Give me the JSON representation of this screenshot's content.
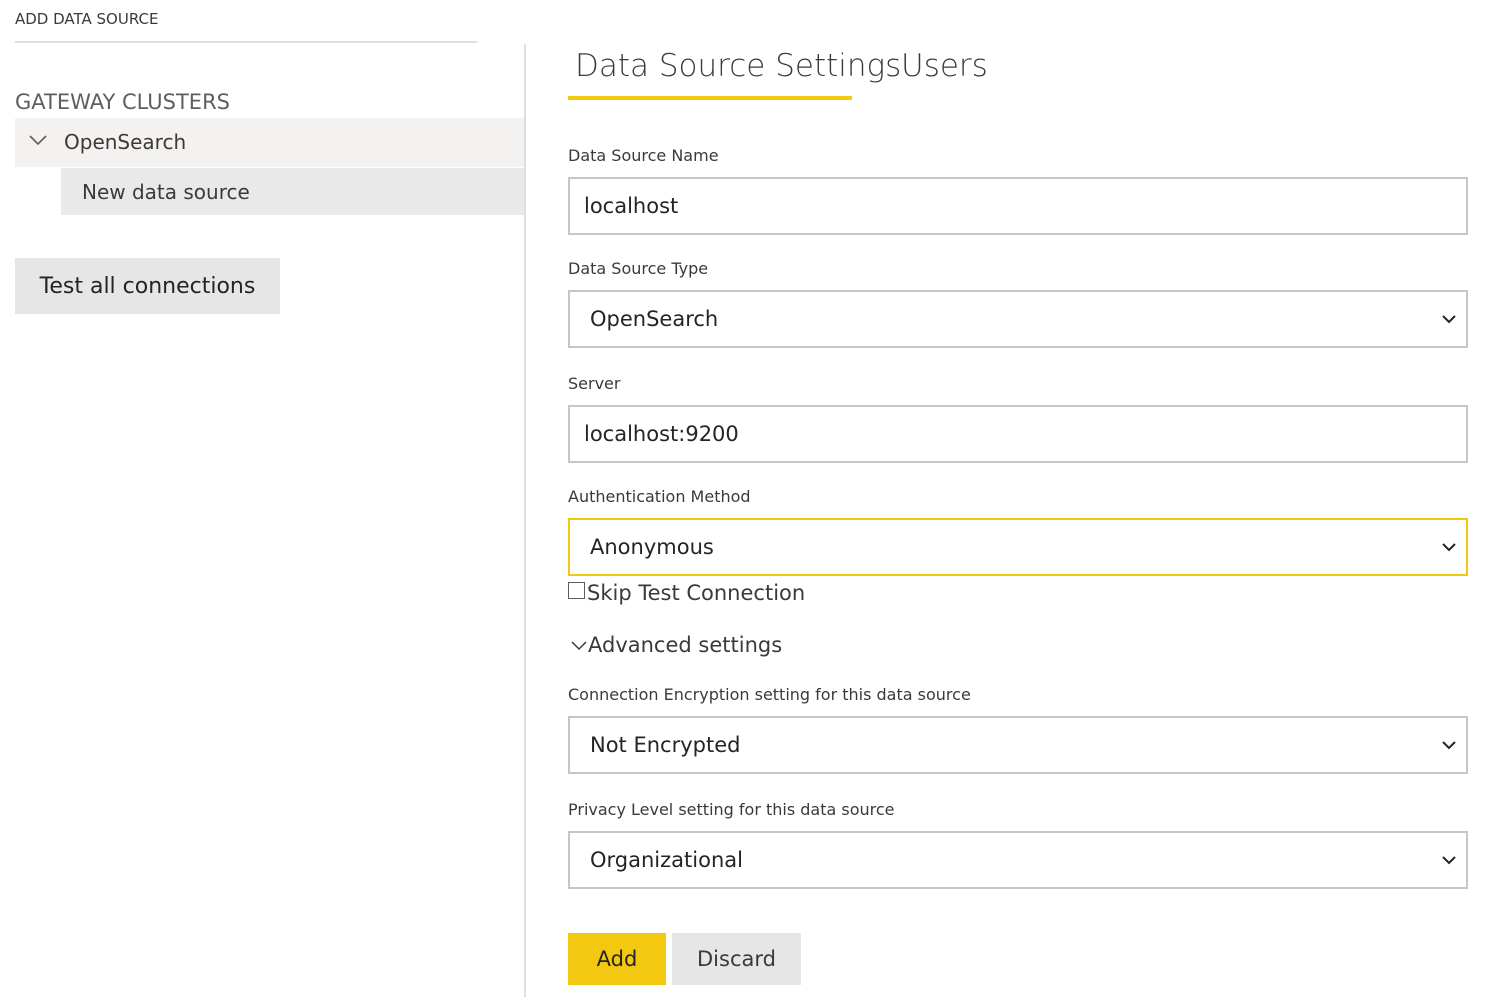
{
  "left": {
    "add_data_source_label": "ADD DATA SOURCE",
    "gateway_clusters_title": "GATEWAY CLUSTERS",
    "cluster": {
      "name": "OpenSearch",
      "expanded_icon": "chevron-down-icon",
      "items": [
        {
          "label": "New data source",
          "selected": true
        }
      ]
    },
    "test_all_label": "Test all connections"
  },
  "tabs": [
    {
      "label": "Data Source Settings",
      "active": true
    },
    {
      "label": "Users",
      "active": false
    }
  ],
  "form": {
    "data_source_name": {
      "label": "Data Source Name",
      "value": "localhost"
    },
    "data_source_type": {
      "label": "Data Source Type",
      "value": "OpenSearch"
    },
    "server": {
      "label": "Server",
      "value": "localhost:9200"
    },
    "authentication_method": {
      "label": "Authentication Method",
      "value": "Anonymous"
    },
    "skip_test_connection": {
      "label": "Skip Test Connection",
      "checked": false
    },
    "advanced_settings_label": "Advanced settings",
    "encryption": {
      "label": "Connection Encryption setting for this data source",
      "value": "Not Encrypted"
    },
    "privacy": {
      "label": "Privacy Level setting for this data source",
      "value": "Organizational"
    }
  },
  "actions": {
    "add_label": "Add",
    "discard_label": "Discard"
  },
  "colors": {
    "accent": "#f2c811",
    "field_border": "#c8c6c4",
    "selected_row": "#e9e9e9",
    "cluster_row": "#f3f2f1",
    "button_gray": "#e6e6e6"
  }
}
